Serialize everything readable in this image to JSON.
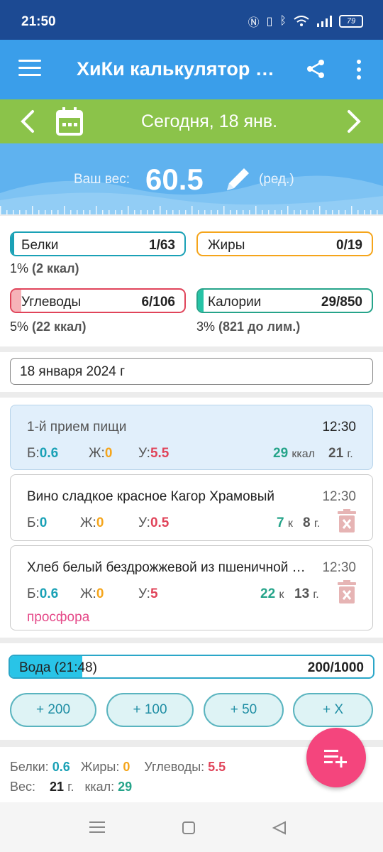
{
  "status": {
    "time": "21:50",
    "battery": "79"
  },
  "appbar": {
    "title": "ХиКи калькулятор калорий",
    "menu_icon": "hamburger-icon",
    "share_icon": "share-icon",
    "more_icon": "more-vert-icon"
  },
  "datebar": {
    "date": "Сегодня, 18 янв.",
    "color": "#8bc34a"
  },
  "weight": {
    "label": "Ваш вес:",
    "value": "60.5",
    "edit": "(ред.)"
  },
  "macros": {
    "protein": {
      "label": "Белки",
      "value": "1/63",
      "sub_pct": "1%",
      "sub_kcal": "(2 ккал)",
      "fraction": 0.016,
      "color": "#1aa1b6"
    },
    "fat": {
      "label": "Жиры",
      "value": "0/19",
      "fraction": 0,
      "color": "#f5a51b"
    },
    "carbs": {
      "label": "Углеводы",
      "value": "6/106",
      "sub_pct": "5%",
      "sub_kcal": "(22 ккал)",
      "fraction": 0.057,
      "color": "#e0445a"
    },
    "calories": {
      "label": "Калории",
      "value": "29/850",
      "sub_pct": "3%",
      "sub_kcal": "(821 до лим.)",
      "fraction": 0.034,
      "color": "#26a48a"
    }
  },
  "date_field": {
    "value": "18 января 2024 г"
  },
  "meal": {
    "name": "1-й прием пищи",
    "time": "12:30",
    "p_label": "Б:",
    "p": "0.6",
    "f_label": "Ж:",
    "f": "0",
    "c_label": "У:",
    "c": "5.5",
    "kcal": "29",
    "kcal_unit": "ккал",
    "grams": "21",
    "grams_unit": "г."
  },
  "items": [
    {
      "name": "Вино сладкое красное Кагор Храмовый",
      "time": "12:30",
      "p_label": "Б:",
      "p": "0",
      "f_label": "Ж:",
      "f": "0",
      "c_label": "У:",
      "c": "0.5",
      "kcal": "7",
      "kcal_unit": "к",
      "grams": "8",
      "grams_unit": "г."
    },
    {
      "name": "Хлеб белый бездрожжевой из пшеничной муки",
      "time": "12:30",
      "p_label": "Б:",
      "p": "0.6",
      "f_label": "Ж:",
      "f": "0",
      "c_label": "У:",
      "c": "5",
      "kcal": "22",
      "kcal_unit": "к",
      "grams": "13",
      "grams_unit": "г.",
      "note": "просфора"
    }
  ],
  "water": {
    "label": "Вода (21:48)",
    "value": "200/1000",
    "fraction": 0.2,
    "buttons": [
      "+ 200",
      "+ 100",
      "+ 50",
      "+ X"
    ]
  },
  "summary": {
    "protein_label": "Белки:",
    "protein": "0.6",
    "fat_label": "Жиры:",
    "fat": "0",
    "carbs_label": "Углеводы:",
    "carbs": "5.5",
    "weight_label": "Вес:",
    "weight": "21",
    "weight_unit": "г.",
    "kcal_label": "ккал:",
    "kcal": "29"
  }
}
